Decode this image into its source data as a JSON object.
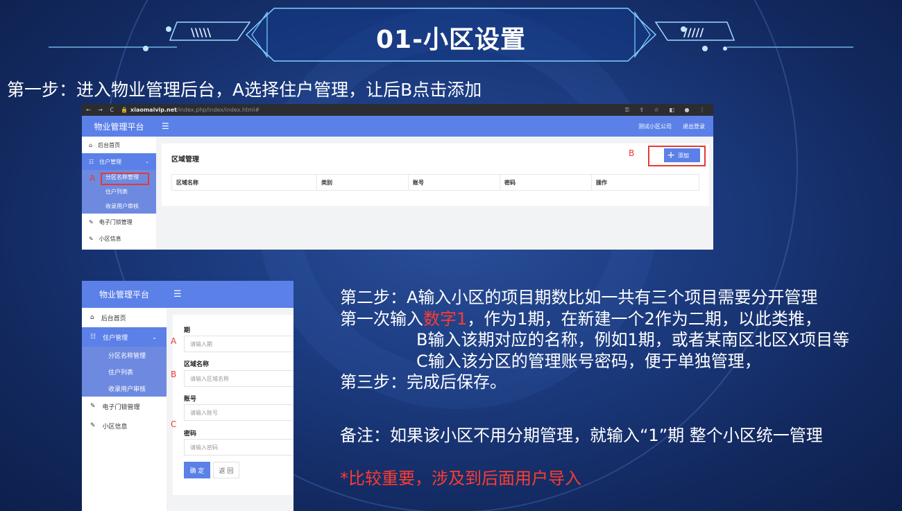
{
  "title": "01-小区设置",
  "step1": "第一步：进入物业管理后台，A选择住户管理，让后B点击添加",
  "shot1": {
    "url_host": "xiaomaivip.net",
    "url_path": "/index.php/index/index.html#",
    "brand": "物业管理平台",
    "header_right": [
      "测试小区公司",
      "退出登录"
    ],
    "sidebar": {
      "home": "后台首页",
      "resident": "住户管理",
      "sub": [
        "分区名称管理",
        "住户列表",
        "收录用户审核"
      ],
      "lock": "电子门锁管理",
      "info": "小区信息"
    },
    "panel_title": "区域管理",
    "columns": [
      "区域名称",
      "类别",
      "账号",
      "密码",
      "操作"
    ],
    "add_label": "添加",
    "marker_a": "A",
    "marker_b": "B"
  },
  "shot2": {
    "brand": "物业管理平台",
    "sidebar": {
      "home": "后台首页",
      "resident": "住户管理",
      "sub": [
        "分区名称管理",
        "住户列表",
        "收录用户审核"
      ],
      "lock": "电子门锁管理",
      "info": "小区信息"
    },
    "fields": [
      {
        "label": "期",
        "placeholder": "请输入期"
      },
      {
        "label": "区域名称",
        "placeholder": "请输入区域名称"
      },
      {
        "label": "账号",
        "placeholder": "请输入账号"
      },
      {
        "label": "密码",
        "placeholder": "请输入密码"
      }
    ],
    "confirm": "确 定",
    "back": "返 回",
    "markers": [
      "A",
      "B",
      "C"
    ]
  },
  "steps": {
    "line1": "第二步：A输入小区的项目期数比如一共有三个项目需要分开管理",
    "line2_pre": "第一次输入",
    "line2_red": "数字1",
    "line2_post": "，作为1期，在新建一个2作为二期，以此类推，",
    "line3": "B输入该期对应的名称，例如1期，或者某南区北区X项目等",
    "line4": "C输入该分区的管理账号密码，便于单独管理，",
    "line5": "第三步：完成后保存。"
  },
  "note": "备注：如果该小区不用分期管理，就输入“1”期 整个小区统一管理",
  "warning": "*比较重要，涉及到后面用户导入"
}
